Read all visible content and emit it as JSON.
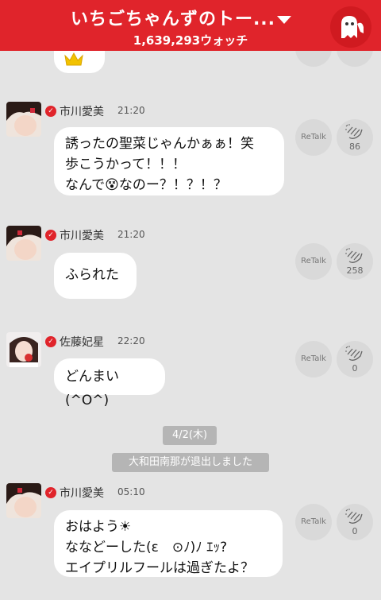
{
  "header": {
    "title": "いちごちゃんずのトー...",
    "watch_count": "1,639,293ウォッチ",
    "icon": "ghost-icon"
  },
  "separator": {
    "date": "4/2(木)",
    "system_message": "大和田南那が退出しました"
  },
  "messages": [
    {
      "name": "市川愛美",
      "time": "21:20",
      "text": "誘ったの聖菜じゃんかぁぁ！笑\n歩こうかって！！！\nなんで😵なのー？！？！？",
      "retalk": "ReTalk",
      "claps": "86"
    },
    {
      "name": "市川愛美",
      "time": "21:20",
      "text": "ふられた",
      "retalk": "ReTalk",
      "claps": "258"
    },
    {
      "name": "佐藤妃星",
      "time": "22:20",
      "text": "どんまい(^O^)",
      "retalk": "ReTalk",
      "claps": "0"
    },
    {
      "name": "市川愛美",
      "time": "05:10",
      "text": "おはよう☀\nななどーした(ε　⊙ﾉ)ﾉ ｴｯ?\nエイプリルフールは過ぎたよ？",
      "retalk": "ReTalk",
      "claps": "0"
    }
  ],
  "colors": {
    "brand_red": "#e0242b",
    "background": "#e4e4e4",
    "action_circle": "#d9d9d9"
  }
}
